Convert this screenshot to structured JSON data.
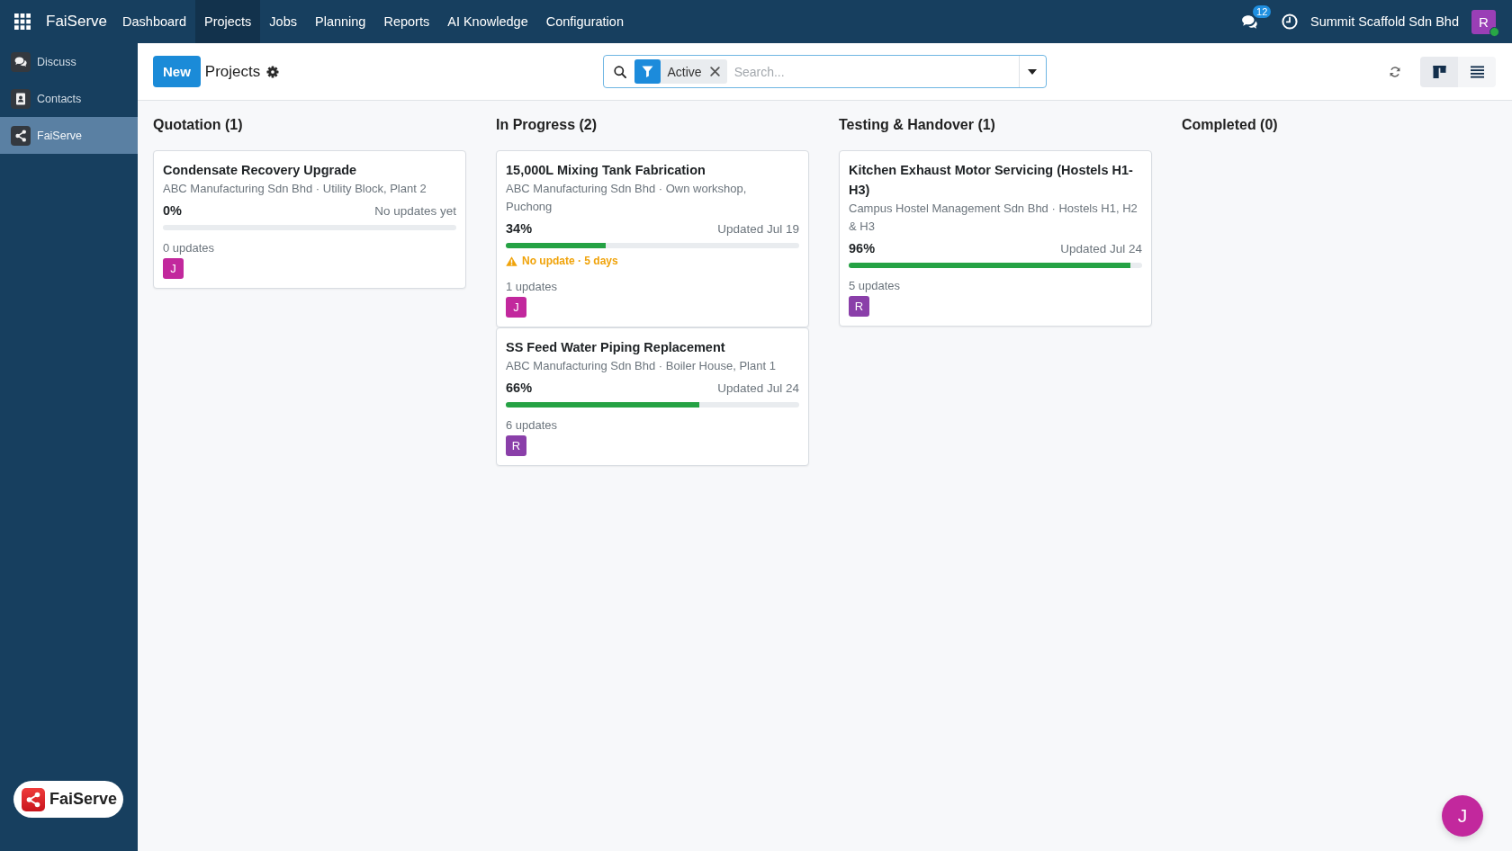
{
  "navbar": {
    "app_name": "FaiServe",
    "menu": [
      {
        "label": "Dashboard",
        "selected": false
      },
      {
        "label": "Projects",
        "selected": true
      },
      {
        "label": "Jobs",
        "selected": false
      },
      {
        "label": "Planning",
        "selected": false
      },
      {
        "label": "Reports",
        "selected": false
      },
      {
        "label": "AI Knowledge",
        "selected": false
      },
      {
        "label": "Configuration",
        "selected": false
      }
    ],
    "message_count": "12",
    "company": "Summit Scaffold Sdn Bhd",
    "user": {
      "initial": "R",
      "online": true
    }
  },
  "sidebar": {
    "items": [
      {
        "label": "Discuss",
        "kind": "discuss",
        "selected": false
      },
      {
        "label": "Contacts",
        "kind": "contacts",
        "selected": false
      },
      {
        "label": "FaiServe",
        "kind": "share",
        "selected": true
      }
    ],
    "brand": "FaiServe"
  },
  "control_panel": {
    "new_button": "New",
    "title": "Projects",
    "search": {
      "facets": [
        {
          "label": "Active"
        }
      ],
      "placeholder": "Search..."
    },
    "views": [
      {
        "kind": "kanban",
        "selected": true
      },
      {
        "kind": "list",
        "selected": false
      }
    ]
  },
  "columns": [
    {
      "title": "Quotation (1)",
      "cards": [
        {
          "title": "Condensate Recovery Upgrade",
          "subtitle": "ABC Manufacturing Sdn Bhd · Utility Block, Plant 2",
          "progress": "0%",
          "level": 0,
          "last_update": "No updates yet",
          "updates": "0 updates",
          "assignee": {
            "initial": "J",
            "color": "#c2289d"
          }
        }
      ]
    },
    {
      "title": "In Progress (2)",
      "cards": [
        {
          "title": "15,000L Mixing Tank Fabrication",
          "subtitle": "ABC Manufacturing Sdn Bhd · Own workshop, Puchong",
          "progress": "34%",
          "level": 0.34,
          "last_update": "Updated Jul 19",
          "warning": "No update · 5 days",
          "updates": "1 updates",
          "assignee": {
            "initial": "J",
            "color": "#c2289d"
          }
        },
        {
          "title": "SS Feed Water Piping Replacement",
          "subtitle": "ABC Manufacturing Sdn Bhd · Boiler House, Plant 1",
          "progress": "66%",
          "level": 0.66,
          "last_update": "Updated Jul 24",
          "updates": "6 updates",
          "assignee": {
            "initial": "R",
            "color": "#8a3fa9"
          }
        }
      ]
    },
    {
      "title": "Testing & Handover (1)",
      "cards": [
        {
          "title": "Kitchen Exhaust Motor Servicing (Hostels H1-H3)",
          "subtitle": "Campus Hostel Management Sdn Bhd · Hostels H1, H2 & H3",
          "progress": "96%",
          "level": 0.96,
          "last_update": "Updated Jul 24",
          "updates": "5 updates",
          "assignee": {
            "initial": "R",
            "color": "#8a3fa9"
          }
        }
      ]
    },
    {
      "title": "Completed (0)"
    }
  ],
  "floating_chat": {
    "initial": "J"
  }
}
